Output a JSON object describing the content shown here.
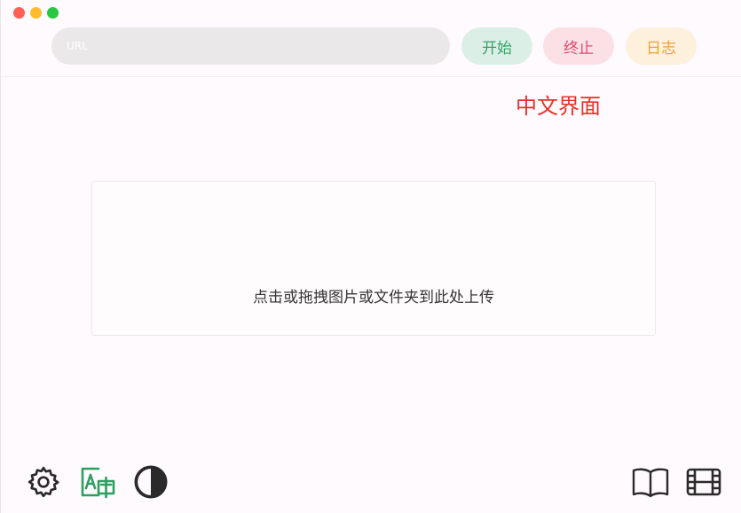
{
  "toolbar": {
    "url_placeholder": "URL",
    "url_value": "",
    "start_label": "开始",
    "stop_label": "终止",
    "log_label": "日志"
  },
  "language_label": "中文界面",
  "dropzone": {
    "hint": "点击或拖拽图片或文件夹到此处上传"
  },
  "bottom_bar": {
    "left_icons": [
      "gear-icon",
      "translate-icon",
      "contrast-icon"
    ],
    "right_icons": [
      "book-icon",
      "film-icon"
    ]
  },
  "colors": {
    "start": "#35a46a",
    "stop": "#e0486a",
    "log": "#eba23a",
    "language_label": "#e8312a",
    "translate_icon": "#2e9f63"
  }
}
